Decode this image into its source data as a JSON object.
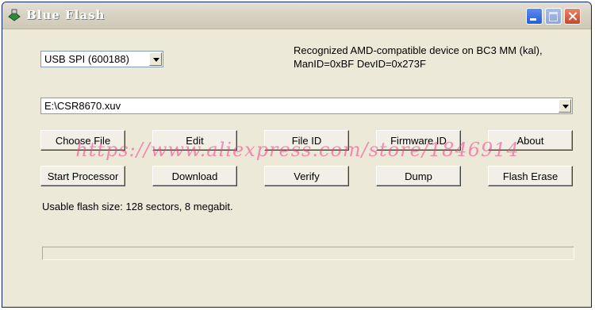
{
  "window": {
    "title": "Blue Flash",
    "buttons": [
      "minimize",
      "maximize",
      "close"
    ]
  },
  "device_select": {
    "value": "USB SPI (600188)"
  },
  "device_info": {
    "line1": "Recognized AMD-compatible device on BC3 MM (kal),",
    "line2": "ManID=0xBF DevID=0x273F"
  },
  "file_select": {
    "value": "E:\\CSR8670.xuv"
  },
  "buttons": {
    "choose_file": "Choose File",
    "edit": "Edit",
    "file_id": "File ID",
    "firmware_id": "Firmware ID",
    "about": "About",
    "start_processor": "Start Processor",
    "download": "Download",
    "verify": "Verify",
    "dump": "Dump",
    "flash_erase": "Flash Erase"
  },
  "status": {
    "text": "Usable flash size: 128 sectors, 8 megabit."
  },
  "progress": {
    "fraction": 0
  },
  "watermark": {
    "text": "https://www.aliexpress.com/store/1846914"
  },
  "colors": {
    "accent": "#2a5ad8",
    "watermark": "#f03c8c"
  },
  "icons": {
    "app": "chip-icon"
  }
}
